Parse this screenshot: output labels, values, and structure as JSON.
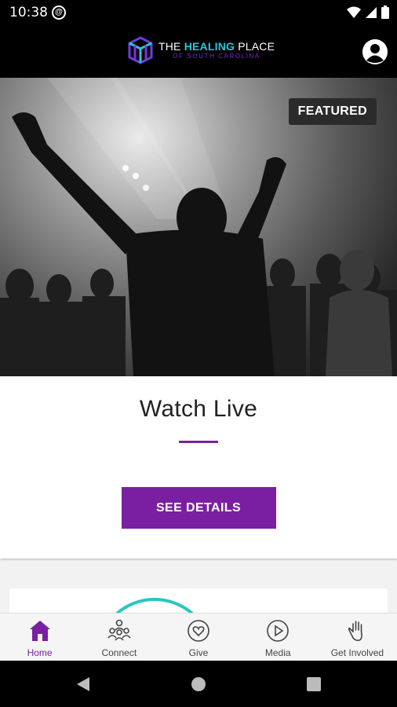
{
  "status_bar": {
    "time": "10:38",
    "sync_glyph": "@",
    "icons": [
      "wifi-icon",
      "cell-signal-icon",
      "battery-icon"
    ]
  },
  "header": {
    "logo": {
      "line1_prefix": "THE ",
      "line1_highlight": "HEALING",
      "line1_suffix": " PLACE",
      "line2": "OF SOUTH CAROLINA"
    },
    "profile_icon": "account-circle-icon"
  },
  "hero": {
    "badge": "FEATURED",
    "image": "worship-crowd-raised-hands-photo"
  },
  "card": {
    "title": "Watch Live",
    "button_label": "SEE DETAILS"
  },
  "bottom_nav": {
    "items": [
      {
        "label": "Home",
        "icon": "home-icon",
        "active": true
      },
      {
        "label": "Connect",
        "icon": "people-icon",
        "active": false
      },
      {
        "label": "Give",
        "icon": "heart-circle-icon",
        "active": false
      },
      {
        "label": "Media",
        "icon": "play-circle-icon",
        "active": false
      },
      {
        "label": "Get Involved",
        "icon": "raised-hand-icon",
        "active": false
      }
    ]
  },
  "colors": {
    "accent": "#7b1fa2",
    "logo_cyan": "#29c6d8",
    "header_bg": "#000000"
  }
}
